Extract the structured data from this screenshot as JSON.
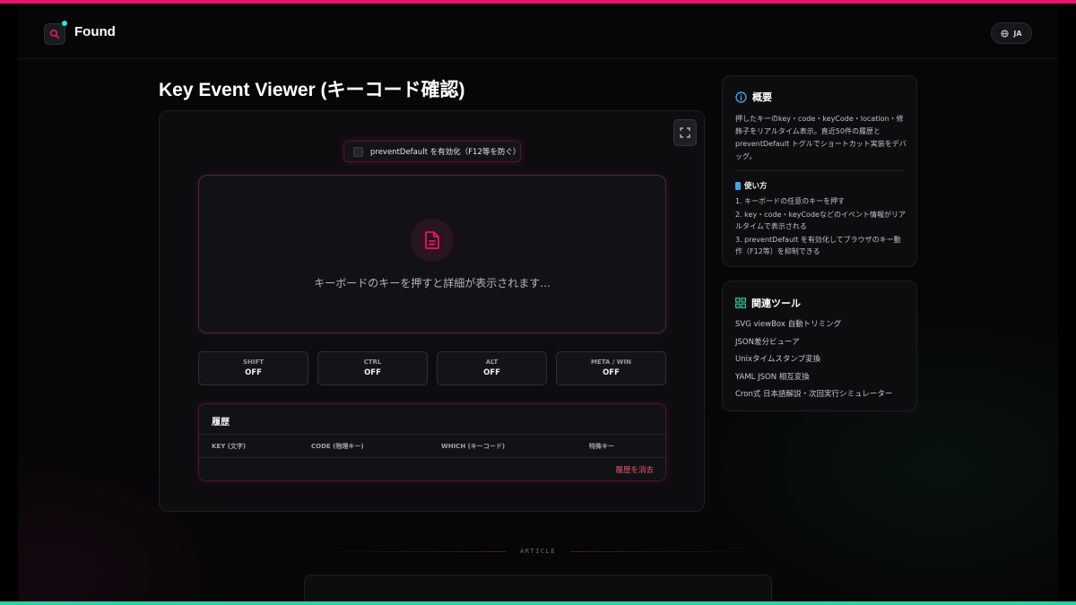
{
  "header": {
    "logo_text": "Found",
    "lang_label": "JA"
  },
  "page": {
    "title": "Key Event Viewer (キーコード確認)"
  },
  "tool": {
    "prevent_default_label": "preventDefault を有効化（F12等を防ぐ）",
    "display_message": "キーボードのキーを押すと詳細が表示されます...",
    "modifiers": [
      {
        "name": "SHIFT",
        "state": "OFF"
      },
      {
        "name": "CTRL",
        "state": "OFF"
      },
      {
        "name": "ALT",
        "state": "OFF"
      },
      {
        "name": "META / WIN",
        "state": "OFF"
      }
    ],
    "history": {
      "title": "履歴",
      "columns": [
        "KEY (文字)",
        "CODE (物理キー)",
        "WHICH (キーコード)",
        "特殊キー"
      ],
      "clear_label": "履歴を消去"
    }
  },
  "overview": {
    "title": "概要",
    "text": "押したキーのkey・code・keyCode・location・修飾子をリアルタイム表示。直近50件の履歴とpreventDefault トグルでショートカット実装をデバッグ。",
    "usage_title": "使い方",
    "usage_steps": [
      "1. キーボードの任意のキーを押す",
      "2. key・code・keyCodeなどのイベント情報がリアルタイムで表示される",
      "3. preventDefault を有効化してブラウザのキー動作（F12等）を抑制できる"
    ]
  },
  "related": {
    "title": "関連ツール",
    "items": [
      "SVG viewBox 自動トリミング",
      "JSON差分ビューア",
      "Unixタイムスタンプ変換",
      "YAML JSON 相互変換",
      "Cron式 日本語解説・次回実行シミュレーター"
    ]
  },
  "article": {
    "label": "ARTICLE"
  },
  "colors": {
    "accent": "#e5156f",
    "secondary": "#26d3a3",
    "danger": "#f0566e"
  }
}
